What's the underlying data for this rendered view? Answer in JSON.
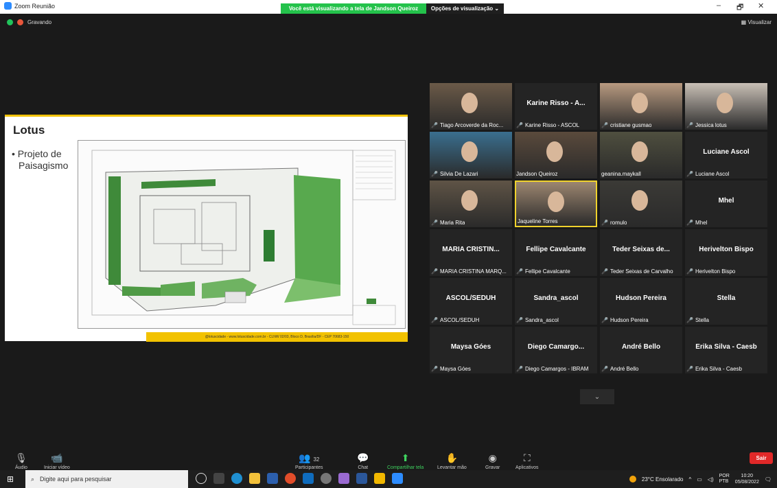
{
  "window": {
    "title": "Zoom Reunião",
    "viewing_banner": "Você está visualizando a tela de Jandson Queiroz",
    "view_options": "Opções de visualização ⌄",
    "minimize": "–",
    "maximize": "🗗",
    "close": "✕"
  },
  "meeting": {
    "recording": "Gravando",
    "view_label": "Visualizar"
  },
  "slide": {
    "title": "Lotus",
    "bullet_line1": "• Projeto de",
    "bullet_line2": "Paisagismo",
    "footer": "@lotuscidade - www.lotuscidade.com.br - CLNW 02/03, Bloco D, Brasília/DF - CEP 70683-150"
  },
  "participants": [
    {
      "name": "Tiago Arcoverde da Roc...",
      "big": "",
      "photo": true,
      "muted": true
    },
    {
      "name": "Karine Risso - ASCOL",
      "big": "Karine Risso - A...",
      "photo": false,
      "muted": true
    },
    {
      "name": "cristiane gusmao",
      "big": "",
      "photo": true,
      "muted": true
    },
    {
      "name": "Jessica lotus",
      "big": "",
      "photo": true,
      "muted": true
    },
    {
      "name": "Silvia De Lazari",
      "big": "",
      "photo": true,
      "muted": true
    },
    {
      "name": "Jandson Queiroz",
      "big": "",
      "photo": true,
      "muted": false
    },
    {
      "name": "geanina.maykall",
      "big": "",
      "photo": true,
      "muted": false
    },
    {
      "name": "Luciane Ascol",
      "big": "Luciane Ascol",
      "photo": false,
      "muted": true
    },
    {
      "name": "Maria Rita",
      "big": "",
      "photo": true,
      "muted": true
    },
    {
      "name": "Jaqueline Torres",
      "big": "",
      "photo": true,
      "muted": false,
      "active": true
    },
    {
      "name": "romulo",
      "big": "",
      "photo": true,
      "muted": true
    },
    {
      "name": "Mhel",
      "big": "Mhel",
      "photo": false,
      "muted": true
    },
    {
      "name": "MARIA CRISTINA MARQ...",
      "big": "MARIA CRISTIN...",
      "photo": false,
      "muted": true
    },
    {
      "name": "Fellipe Cavalcante",
      "big": "Fellipe Cavalcante",
      "photo": false,
      "muted": true
    },
    {
      "name": "Teder Seixas de Carvalho",
      "big": "Teder Seixas de...",
      "photo": false,
      "muted": true
    },
    {
      "name": "Herivelton Bispo",
      "big": "Herivelton Bispo",
      "photo": false,
      "muted": true
    },
    {
      "name": "ASCOL/SEDUH",
      "big": "ASCOL/SEDUH",
      "photo": false,
      "muted": true
    },
    {
      "name": "Sandra_ascol",
      "big": "Sandra_ascol",
      "photo": false,
      "muted": true
    },
    {
      "name": "Hudson Pereira",
      "big": "Hudson Pereira",
      "photo": false,
      "muted": true
    },
    {
      "name": "Stella",
      "big": "Stella",
      "photo": false,
      "muted": true
    },
    {
      "name": "Maysa Góes",
      "big": "Maysa Góes",
      "photo": false,
      "muted": true
    },
    {
      "name": "Diego Camargos - IBRAM",
      "big": "Diego Camargo...",
      "photo": false,
      "muted": true
    },
    {
      "name": "André Bello",
      "big": "André Bello",
      "photo": false,
      "muted": true
    },
    {
      "name": "Erika Silva - Caesb",
      "big": "Erika Silva - Caesb",
      "photo": false,
      "muted": true
    }
  ],
  "toolbar": {
    "audio": "Áudio",
    "video": "Iniciar vídeo",
    "participants": "Participantes",
    "participants_count": "32",
    "chat": "Chat",
    "share": "Compartilhar tela",
    "raise_hand": "Levantar mão",
    "record": "Gravar",
    "apps": "Aplicativos",
    "leave": "Sair"
  },
  "taskbar": {
    "search_placeholder": "Digite aqui para pesquisar",
    "weather": "23°C  Ensolarado",
    "lang1": "POR",
    "lang2": "PTB",
    "time": "10:20",
    "date": "05/08/2022"
  },
  "colors": {
    "banner_green": "#24c24b",
    "accent_yellow": "#f2c200",
    "leave_red": "#e02828"
  }
}
